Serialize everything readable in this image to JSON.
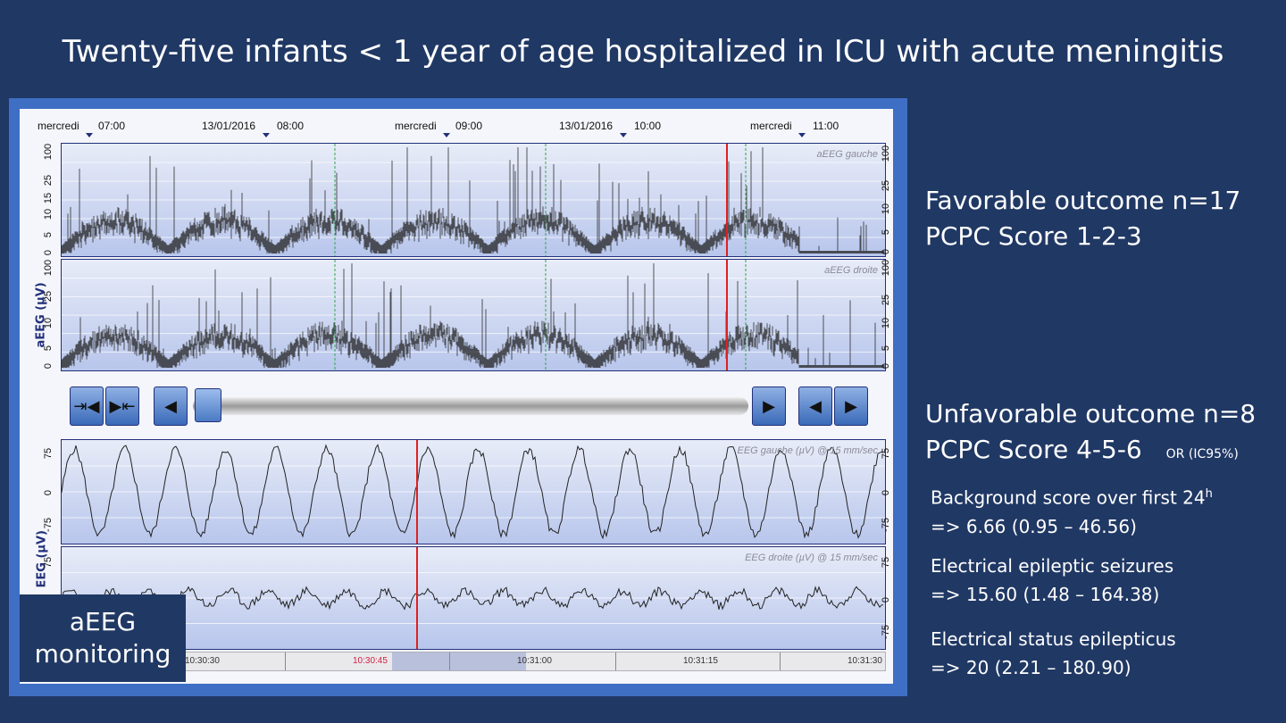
{
  "slide": {
    "title": "Twenty-five infants < 1 year of age hospitalized in ICU with acute meningitis"
  },
  "header_times": [
    {
      "label": "mercredi"
    },
    {
      "label": "07:00"
    },
    {
      "label": "13/01/2016"
    },
    {
      "label": "08:00"
    },
    {
      "label": "mercredi"
    },
    {
      "label": "09:00"
    },
    {
      "label": "13/01/2016"
    },
    {
      "label": "10:00"
    },
    {
      "label": "mercredi"
    },
    {
      "label": "11:00"
    }
  ],
  "aeeg": {
    "axis_title": "aEEG (µV)",
    "left_ticks": [
      "100",
      "25",
      "15",
      "10",
      "5",
      "0"
    ],
    "right_ticks": [
      "100",
      "25",
      "10",
      "5",
      "0"
    ],
    "left_label": "aEEG gauche",
    "right_label": "aEEG droite"
  },
  "eeg": {
    "axis_title": "EEG (µV)",
    "ticks": [
      "75",
      "0",
      "-75"
    ],
    "left_label": "EEG gauche  (µV) @ 15 mm/sec",
    "right_label": "EEG droite (µV) @ 15 mm/sec"
  },
  "timeline": {
    "labels": [
      "10:30:30",
      "10:30:45",
      "10:31:00",
      "10:31:15",
      "10:31:30"
    ]
  },
  "badge": {
    "line1": "aEEG",
    "line2": "monitoring"
  },
  "outcomes": {
    "favorable": {
      "line1": "Favorable outcome n=17",
      "line2": "PCPC Score 1-2-3"
    },
    "unfavorable": {
      "line1": "Unfavorable outcome n=8",
      "line2": "PCPC Score 4-5-6",
      "or_label": "OR (IC95%)"
    },
    "stats": [
      {
        "label": "Background score over first 24",
        "sup": "h",
        "value": "=> 6.66 (0.95 – 46.56)"
      },
      {
        "label": "Electrical epileptic seizures",
        "value": "=> 15.60 (1.48 – 164.38)"
      },
      {
        "label": "Electrical status epilepticus",
        "value": "=> 20 (2.21 – 180.90)"
      }
    ]
  },
  "colors": {
    "background": "#203864",
    "trace": "#222222",
    "cursor": "#e02020",
    "marker": "#2ea84a"
  },
  "icons": [
    "zoom-in-icon",
    "zoom-out-icon",
    "prev-icon",
    "next-icon",
    "step-back-icon",
    "step-forward-icon"
  ]
}
